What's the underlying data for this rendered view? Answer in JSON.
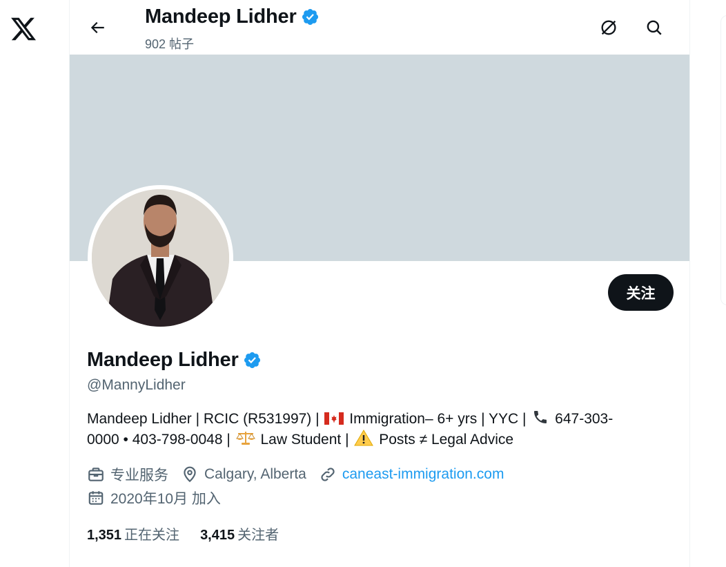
{
  "header": {
    "name": "Mandeep Lidher",
    "post_count": "902 帖子"
  },
  "profile": {
    "name": "Mandeep Lidher",
    "handle": "@MannyLidher",
    "follow_label": "关注",
    "bio_line1_a": "Mandeep Lidher | RCIC (R531997) |",
    "bio_line1_b": "Immigration– 6+ yrs | YYC |",
    "bio_line1_c": "647-303-",
    "bio_line2_a": "0000 • 403-798-0048 |",
    "bio_line2_b": "Law Student |",
    "bio_line2_c": "Posts ≠ Legal Advice",
    "category": "专业服务",
    "location": "Calgary, Alberta",
    "website": "caneast-immigration.com",
    "joined": "2020年10月 加入"
  },
  "stats": {
    "following_count": "1,351",
    "following_label": "正在关注",
    "followers_count": "3,415",
    "followers_label": "关注者"
  },
  "icons": {
    "logo": "x-logo-icon",
    "back": "arrow-left-icon",
    "grok": "grok-icon",
    "search": "search-icon",
    "verified": "verified-badge-icon",
    "category": "briefcase-icon",
    "location": "location-pin-icon",
    "website": "link-icon",
    "joined": "calendar-icon"
  },
  "colors": {
    "text": "#0f1419",
    "secondary": "#536471",
    "accent": "#1d9bf0",
    "banner": "#cfd9de",
    "button": "#0f1419"
  }
}
